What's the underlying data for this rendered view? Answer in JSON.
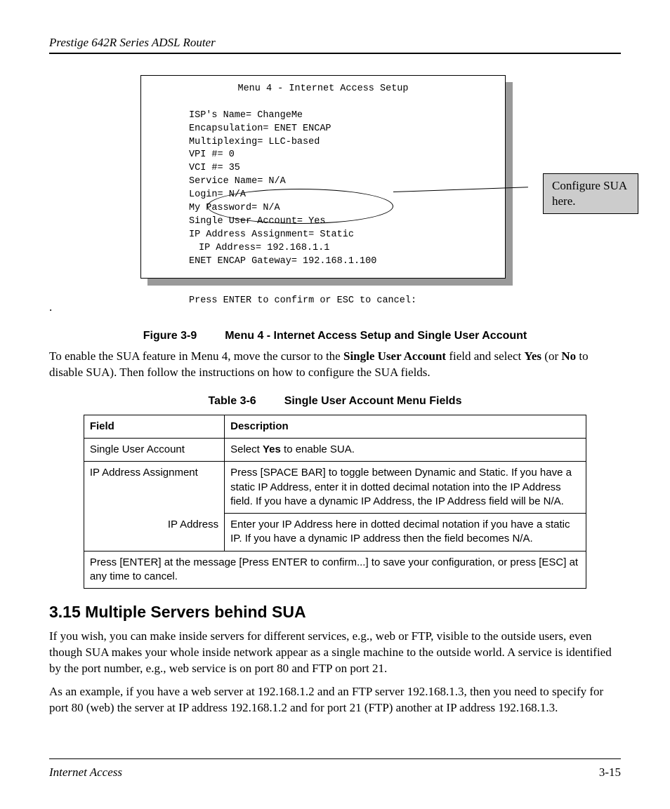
{
  "header": "Prestige 642R Series ADSL Router",
  "terminal": {
    "title": "Menu 4 - Internet Access Setup",
    "lines": {
      "isp": "ISP's Name= ChangeMe",
      "encap": "Encapsulation= ENET ENCAP",
      "multi": "Multiplexing= LLC-based",
      "vpi": "VPI #=  0",
      "vci": "VCI #=  35",
      "svc": "Service Name= N/A",
      "login": "Login= N/A",
      "pwd": "My Password= N/A",
      "sua": "Single User Account= Yes",
      "ipasg": "IP Address Assignment= Static",
      "ipaddr": "IP Address= 192.168.1.1",
      "gw": "ENET ENCAP Gateway= 192.168.1.100",
      "prompt": "Press ENTER to confirm or ESC to cancel:"
    }
  },
  "callout": "Configure SUA here.",
  "figure": {
    "num": "Figure 3-9",
    "title": "Menu 4 - Internet Access Setup and Single User Account"
  },
  "para_enable_pre": "To enable the SUA feature in Menu 4, move the cursor to the ",
  "para_enable_b1": "Single User Account",
  "para_enable_mid": " field and select ",
  "para_enable_b2": "Yes",
  "para_enable_post": " (or ",
  "para_enable_b3": "No",
  "para_enable_end": " to disable SUA). Then follow the instructions on how to configure the SUA fields.",
  "tablecap": {
    "num": "Table 3-6",
    "title": "Single User Account Menu Fields"
  },
  "th_field": "Field",
  "th_desc": "Description",
  "rows": {
    "r1f": "Single User Account",
    "r1d_pre": "Select ",
    "r1d_b": "Yes",
    "r1d_post": " to enable SUA.",
    "r2f": " IP Address Assignment",
    "r2d": "Press [SPACE BAR] to toggle between Dynamic and Static. If you have a static IP Address, enter it in dotted decimal notation into the IP Address field.  If you have a dynamic IP Address, the IP Address field will be N/A.",
    "r3f": "IP Address",
    "r3d": "Enter your IP Address here in dotted decimal notation if you have a static IP.  If you have a dynamic IP address then  the field becomes N/A.",
    "r4": "Press [ENTER] at the message [Press ENTER to confirm...] to save your configuration, or press [ESC] at any time to cancel."
  },
  "section": "3.15  Multiple Servers behind SUA",
  "para2": "If you wish, you can make inside servers for different services, e.g., web or FTP, visible to the outside users, even though SUA makes your whole inside network appear as a single machine to the outside world.  A service is identified by the port number, e.g., web service is on port 80 and FTP on port 21.",
  "para3": "As an example, if you have a web server at 192.168.1.2 and an FTP server 192.168.1.3, then you need to specify for port 80 (web) the server at IP address 192.168.1.2 and for port 21 (FTP) another at IP address 192.168.1.3.",
  "footer": {
    "title": "Internet Access",
    "page": "3-15"
  }
}
